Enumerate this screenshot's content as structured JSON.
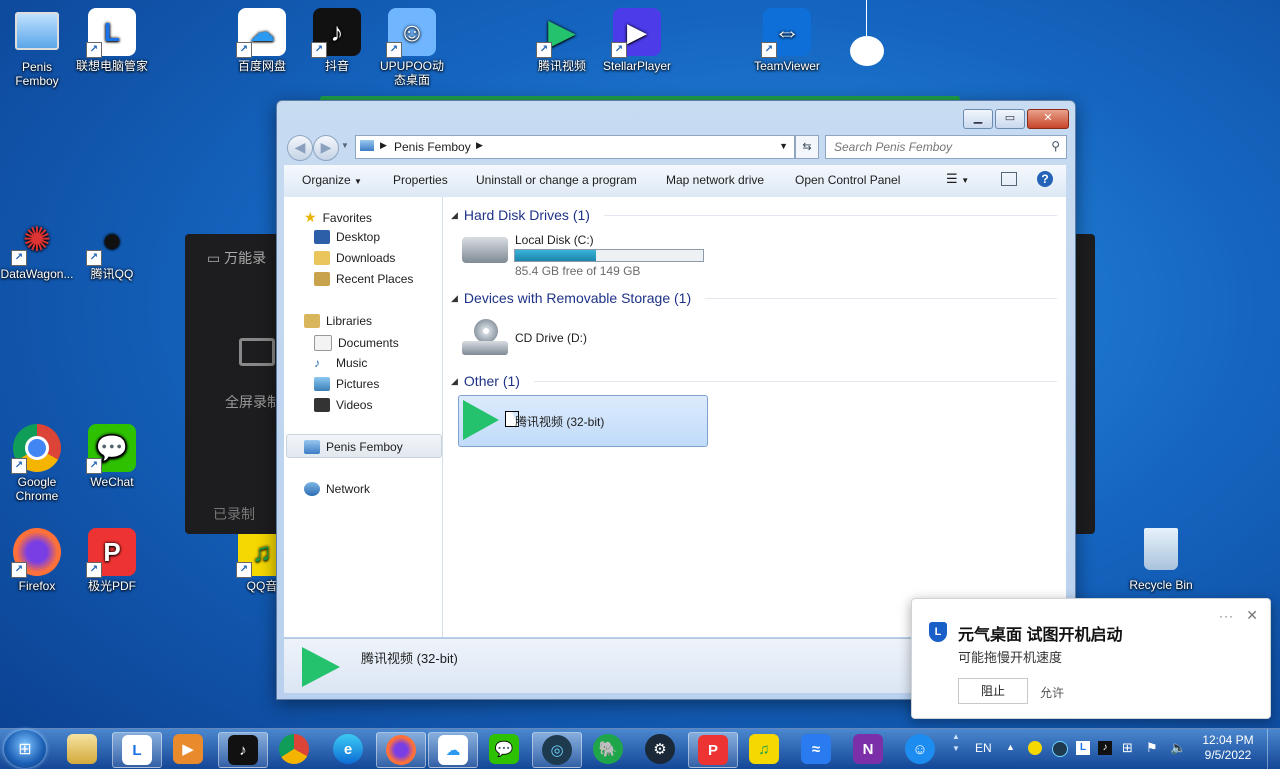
{
  "desktop": {
    "icons": [
      {
        "label": "Penis Femboy",
        "icon": "computer-icon"
      },
      {
        "label": "联想电脑管家",
        "icon": "lenovo-icon"
      },
      {
        "label": "百度网盘",
        "icon": "baidu-netdisk-icon"
      },
      {
        "label": "抖音",
        "icon": "douyin-icon"
      },
      {
        "label": "UPUPOO动态桌面",
        "icon": "upupoo-icon"
      },
      {
        "label": "腾讯视频",
        "icon": "tencent-video-icon"
      },
      {
        "label": "StellarPlayer",
        "icon": "stellar-player-icon"
      },
      {
        "label": "TeamViewer",
        "icon": "teamviewer-icon"
      },
      {
        "label": "DataWagon...",
        "icon": "datawagon-icon"
      },
      {
        "label": "腾讯QQ",
        "icon": "qq-icon"
      },
      {
        "label": "Google Chrome",
        "icon": "chrome-icon"
      },
      {
        "label": "WeChat",
        "icon": "wechat-icon"
      },
      {
        "label": "Firefox",
        "icon": "firefox-icon"
      },
      {
        "label": "极光PDF",
        "icon": "pdf-icon"
      },
      {
        "label": "QQ音",
        "icon": "qq-music-icon"
      },
      {
        "label": "Recycle Bin",
        "icon": "recycle-bin-icon"
      }
    ],
    "background_panel": {
      "title": "万能录",
      "fullscreen_label": "全屏录制",
      "footer": "已录制"
    }
  },
  "explorer": {
    "address": {
      "location": "Penis Femboy"
    },
    "search": {
      "placeholder": "Search Penis Femboy"
    },
    "toolbar": {
      "organize": "Organize",
      "properties": "Properties",
      "uninstall": "Uninstall or change a program",
      "map_drive": "Map network drive",
      "control_panel": "Open Control Panel"
    },
    "nav": {
      "favorites": "Favorites",
      "desktop": "Desktop",
      "downloads": "Downloads",
      "recent": "Recent Places",
      "libraries": "Libraries",
      "documents": "Documents",
      "music": "Music",
      "pictures": "Pictures",
      "videos": "Videos",
      "computer": "Penis Femboy",
      "network": "Network"
    },
    "groups": {
      "hdd": "Hard Disk Drives (1)",
      "removable": "Devices with Removable Storage (1)",
      "other": "Other (1)"
    },
    "local_disk": {
      "name": "Local Disk (C:)",
      "free_text": "85.4 GB free of 149 GB",
      "used_fraction": 0.43
    },
    "cd_drive": {
      "name": "CD Drive (D:)"
    },
    "other_item": {
      "name": "腾讯视频 (32-bit)"
    },
    "details": {
      "name": "腾讯视频 (32-bit)"
    }
  },
  "notification": {
    "title": "元气桌面 试图开机启动",
    "body": "可能拖慢开机速度",
    "block": "阻止",
    "allow": "允许",
    "more": "···"
  },
  "taskbar": {
    "apps": [
      "explorer",
      "lenovo",
      "video",
      "douyin",
      "chrome",
      "edge",
      "firefox",
      "baidu-netdisk",
      "wechat",
      "gpu-tool",
      "evernote",
      "steam",
      "pdf",
      "qq-music",
      "feishu",
      "onenote",
      "bot"
    ],
    "lang": "EN",
    "time": "12:04 PM",
    "date": "9/5/2022"
  },
  "colors": {
    "accent": "#1a86ad",
    "desktop": "#1565c0",
    "group_header": "#1e3287"
  }
}
